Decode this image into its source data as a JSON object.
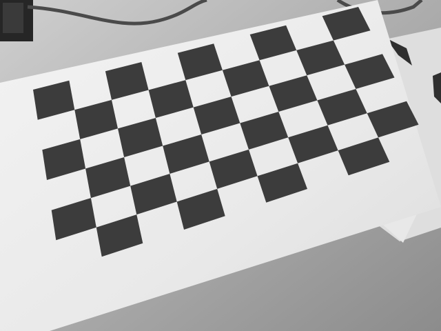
{
  "image": {
    "kind": "photograph",
    "colorspace": "grayscale",
    "subject": "printed-checkerboard-calibration-pattern"
  },
  "pattern": {
    "rows": 6,
    "columns": 9,
    "square_color": "#3f3f3f",
    "paper_color": "#ededed"
  },
  "colors": {
    "table": "#9a9a9a",
    "table_light": "#c2c2c2",
    "paper": "#ededed",
    "paper_shadow": "#d2d2d2",
    "square": "#3c3c3c",
    "cable": "#4e4e4e",
    "device": "#2a2a2a",
    "under_sheet": "#dcdcdc"
  }
}
